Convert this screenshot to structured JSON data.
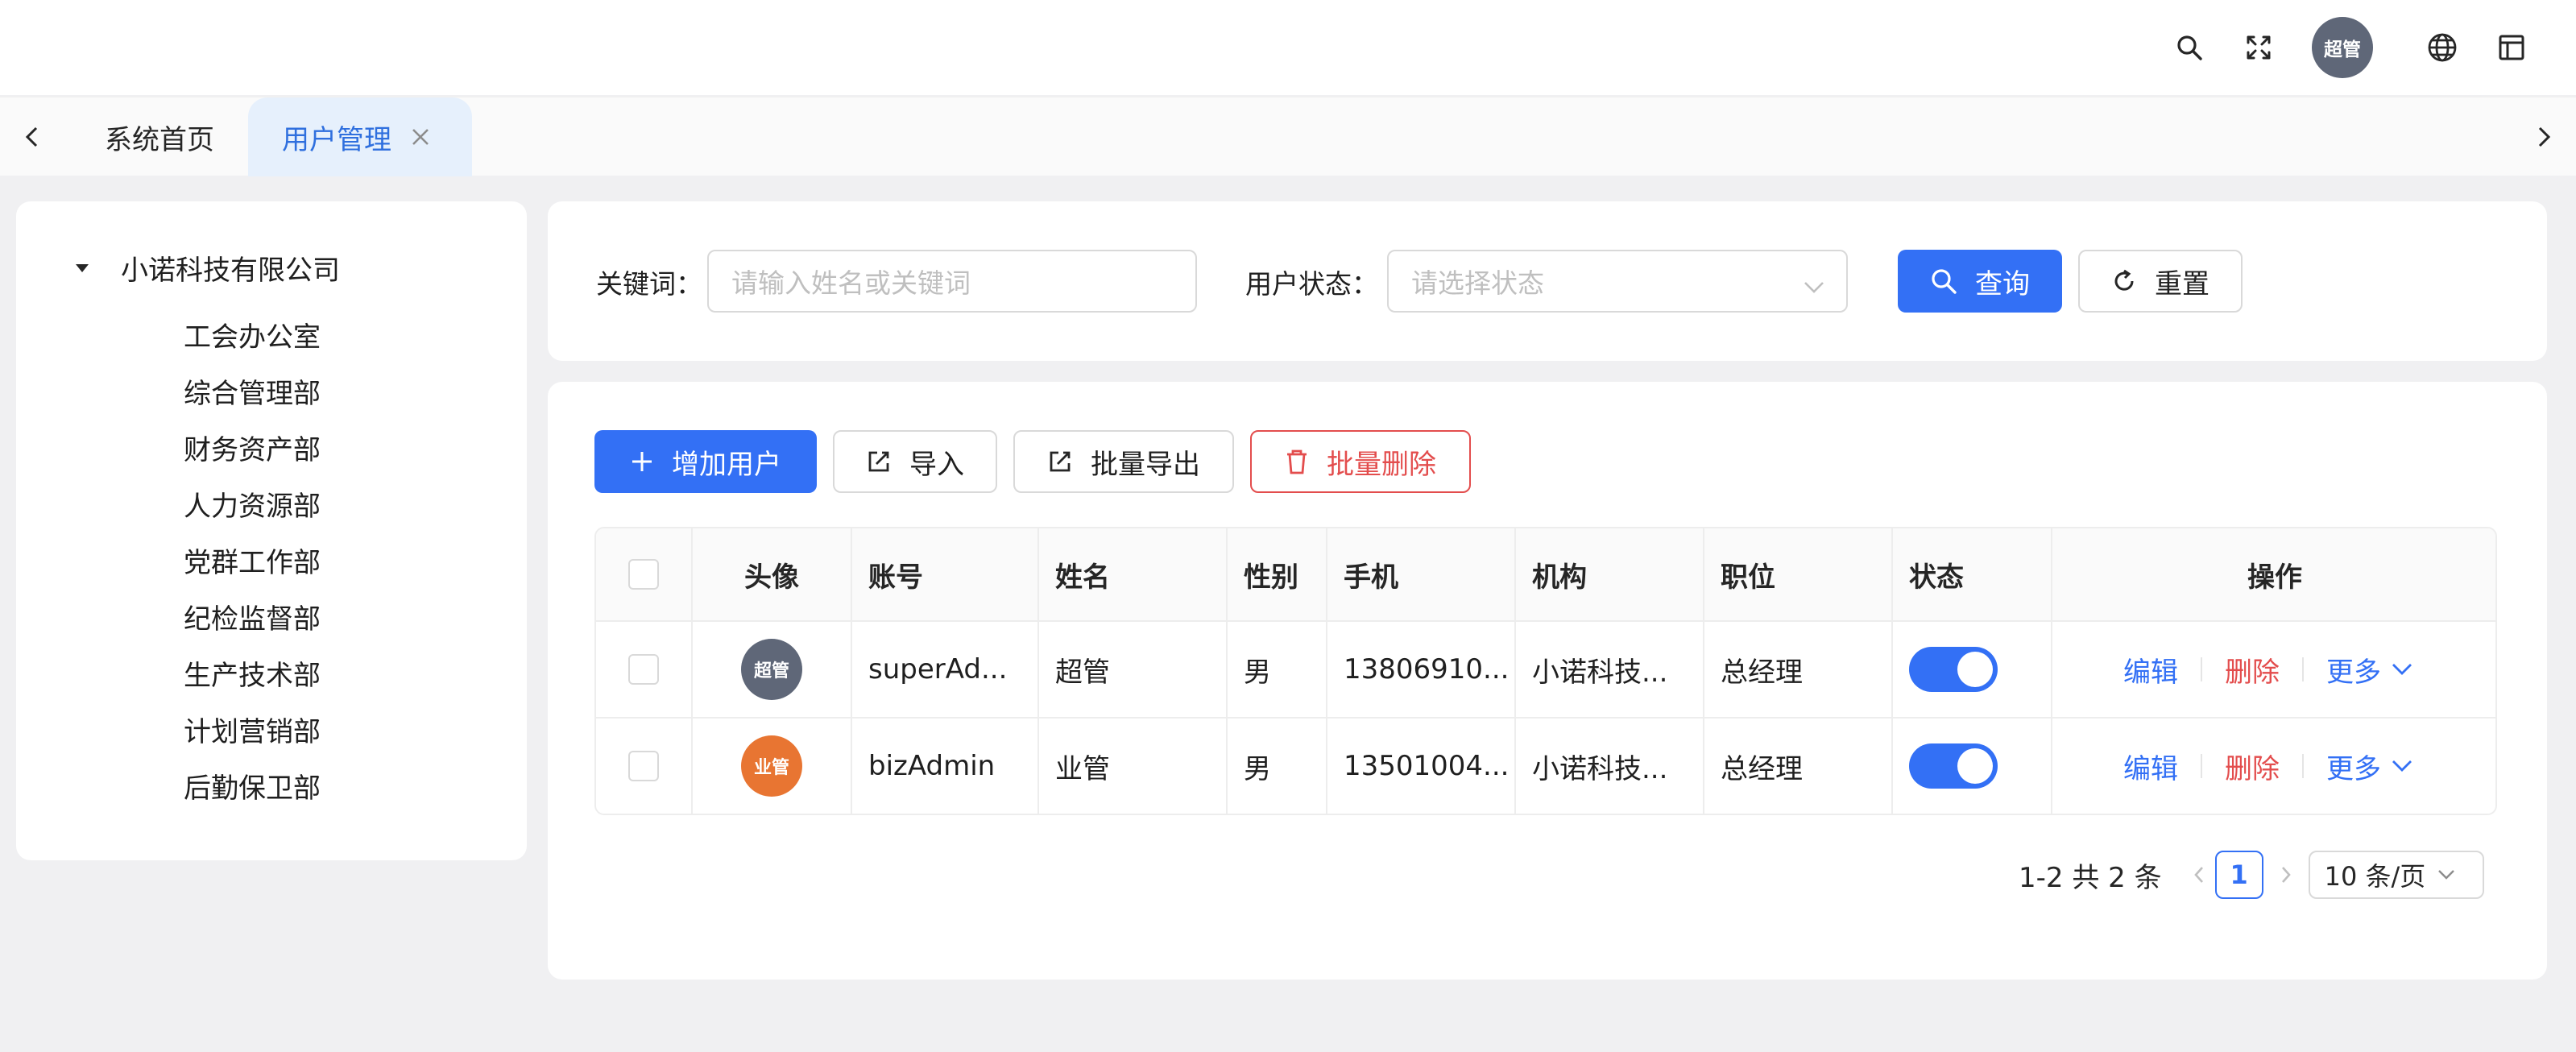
{
  "header": {
    "avatar_text": "超管",
    "icons": [
      "search-icon",
      "fullscreen-icon",
      "globe-icon",
      "layout-icon"
    ]
  },
  "tabs": {
    "items": [
      {
        "label": "系统首页",
        "active": false
      },
      {
        "label": "用户管理",
        "active": true
      }
    ]
  },
  "tree": {
    "root": "小诺科技有限公司",
    "children": [
      "工会办公室",
      "综合管理部",
      "财务资产部",
      "人力资源部",
      "党群工作部",
      "纪检监督部",
      "生产技术部",
      "计划营销部",
      "后勤保卫部"
    ]
  },
  "search": {
    "keyword_label": "关键词：",
    "keyword_placeholder": "请输入姓名或关键词",
    "status_label": "用户状态：",
    "status_placeholder": "请选择状态",
    "query_label": "查询",
    "reset_label": "重置"
  },
  "toolbar": {
    "add_label": "增加用户",
    "import_label": "导入",
    "export_label": "批量导出",
    "delete_label": "批量删除"
  },
  "table": {
    "headers": [
      "头像",
      "账号",
      "姓名",
      "性别",
      "手机",
      "机构",
      "职位",
      "状态",
      "操作"
    ],
    "rows": [
      {
        "avatar": "超管",
        "avatar_color": "#5f6778",
        "account": "superAd...",
        "name": "超管",
        "gender": "男",
        "phone": "13806910...",
        "org": "小诺科技...",
        "position": "总经理",
        "enabled": true,
        "edit": "编辑",
        "delete": "删除",
        "more": "更多"
      },
      {
        "avatar": "业管",
        "avatar_color": "#e87532",
        "account": "bizAdmin",
        "name": "业管",
        "gender": "男",
        "phone": "13501004...",
        "org": "小诺科技...",
        "position": "总经理",
        "enabled": true,
        "edit": "编辑",
        "delete": "删除",
        "more": "更多"
      }
    ]
  },
  "pagination": {
    "total_text": "1-2 共 2 条",
    "current_page": "1",
    "page_size": "10 条/页"
  },
  "colors": {
    "primary": "#3370f5",
    "danger": "#e34d4d",
    "tab_active_bg": "#e6f0fc"
  }
}
